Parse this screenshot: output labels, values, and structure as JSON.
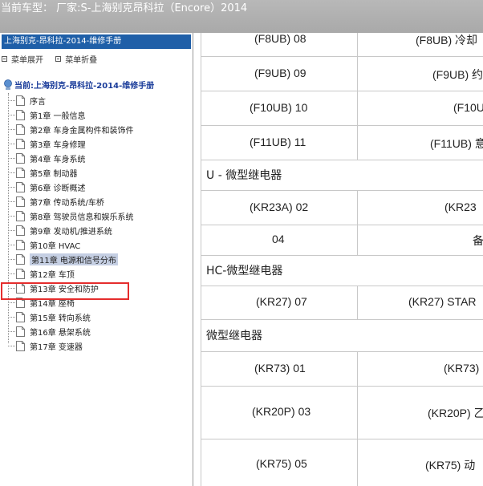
{
  "window": {
    "title": "当前车型： 厂家:S-上海别克昂科拉（Encore）2014"
  },
  "sidebar": {
    "manual_title": "上海别克-昂科拉-2014-维修手册",
    "expand_label": "菜单展开",
    "collapse_label": "菜单折叠",
    "root_label": "当前:上海别克-昂科拉-2014-维修手册",
    "items": [
      {
        "label": "序言"
      },
      {
        "label": "第1章 一般信息"
      },
      {
        "label": "第2章 车身金属构件和装饰件"
      },
      {
        "label": "第3章 车身修理"
      },
      {
        "label": "第4章 车身系统"
      },
      {
        "label": "第5章 制动器"
      },
      {
        "label": "第6章 诊断概述"
      },
      {
        "label": "第7章 传动系统/车桥"
      },
      {
        "label": "第8章 驾驶员信息和娱乐系统"
      },
      {
        "label": "第9章 发动机/推进系统"
      },
      {
        "label": "第10章 HVAC"
      },
      {
        "label": "第11章 电源和信号分布"
      },
      {
        "label": "第12章 车顶"
      },
      {
        "label": "第13章 安全和防护"
      },
      {
        "label": "第14章 座椅"
      },
      {
        "label": "第15章 转向系统"
      },
      {
        "label": "第16章 悬架系统"
      },
      {
        "label": "第17章 变速器"
      }
    ],
    "selected_index": 11
  },
  "content": {
    "rows": [
      {
        "c1": "(F8UB) 08",
        "c2": "(F8UB) 冷却"
      },
      {
        "c1": "(F9UB) 09",
        "c2": "(F9UB) 约"
      },
      {
        "c1": "(F10UB) 10",
        "c2": "(F10U"
      },
      {
        "c1": "(F11UB) 11",
        "c2": "(F11UB) 意"
      }
    ],
    "heading_u": "U - 微型继电器",
    "rows_u": [
      {
        "c1": "(KR23A) 02",
        "c2": "(KR23"
      },
      {
        "c1": "04",
        "c2": "备"
      }
    ],
    "heading_hc": "HC-微型继电器",
    "rows_hc": [
      {
        "c1": "(KR27) 07",
        "c2": "(KR27) STAR"
      }
    ],
    "heading_micro": "微型继电器",
    "rows_micro": [
      {
        "c1": "(KR73) 01",
        "c2": "(KR73)"
      },
      {
        "c1": "(KR20P) 03",
        "c2": "(KR20P) 乙"
      },
      {
        "c1": "(KR75) 05",
        "c2": "(KR75) 动"
      }
    ]
  }
}
